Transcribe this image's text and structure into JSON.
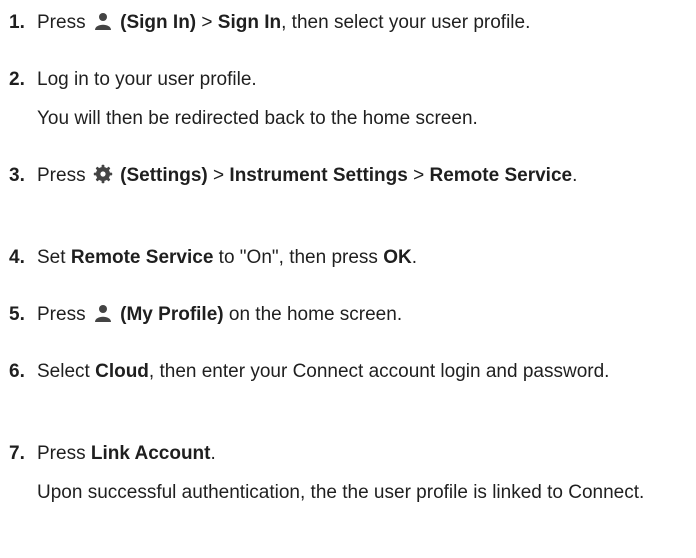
{
  "steps": [
    {
      "number": "1.",
      "press": "Press",
      "sign_in_label": "(Sign In)",
      "gt1": ">",
      "sign_in_menu": "Sign In",
      "rest": ", then select your user profile."
    },
    {
      "number": "2.",
      "text": "Log in to your user profile.",
      "note": "You will then be redirected back to the home screen."
    },
    {
      "number": "3.",
      "press": "Press",
      "settings_label": "(Settings)",
      "gt1": ">",
      "instrument_settings": "Instrument Settings",
      "gt2": ">",
      "remote_service": "Remote Service",
      "period": "."
    },
    {
      "number": "4.",
      "set": "Set",
      "remote_service": "Remote Service",
      "mid": "to \"On\", then press",
      "ok": "OK",
      "period": "."
    },
    {
      "number": "5.",
      "press": "Press",
      "my_profile_label": "(My Profile)",
      "rest": "on the home screen."
    },
    {
      "number": "6.",
      "select": "Select",
      "cloud": "Cloud",
      "rest": ", then enter your Connect account login and password."
    },
    {
      "number": "7.",
      "press": "Press",
      "link_account": "Link Account",
      "period": ".",
      "note": "Upon successful authentication, the the user profile is linked to Connect."
    }
  ],
  "icons": {
    "user": "user-icon",
    "settings": "gear-icon"
  },
  "colors": {
    "text": "#1f1f1f",
    "icon": "#444444"
  }
}
